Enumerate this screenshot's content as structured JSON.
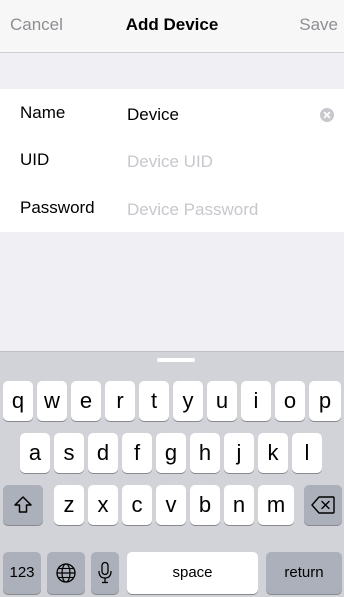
{
  "nav": {
    "cancel_label": "Cancel",
    "title": "Add Device",
    "save_label": "Save"
  },
  "form": {
    "fields": [
      {
        "label": "Name",
        "value": "Device",
        "placeholder": ""
      },
      {
        "label": "UID",
        "value": "",
        "placeholder": "Device UID"
      },
      {
        "label": "Password",
        "value": "",
        "placeholder": "Device Password"
      }
    ]
  },
  "keyboard": {
    "row1": [
      "q",
      "w",
      "e",
      "r",
      "t",
      "y",
      "u",
      "i",
      "o",
      "p"
    ],
    "row2": [
      "a",
      "s",
      "d",
      "f",
      "g",
      "h",
      "j",
      "k",
      "l"
    ],
    "row3": [
      "z",
      "x",
      "c",
      "v",
      "b",
      "n",
      "m"
    ],
    "numbers_label": "123",
    "space_label": "space",
    "return_label": "return",
    "icons": {
      "shift": "shift-icon",
      "delete": "delete-icon",
      "globe": "globe-icon",
      "mic": "microphone-icon",
      "clear": "clear-icon"
    }
  }
}
